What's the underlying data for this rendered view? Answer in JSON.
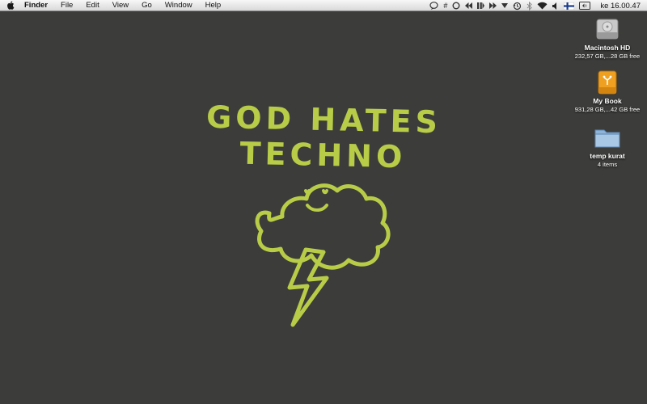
{
  "menubar": {
    "app_name": "Finder",
    "items": [
      "File",
      "Edit",
      "View",
      "Go",
      "Window",
      "Help"
    ],
    "status_icons": [
      "spotlight-bubble-icon",
      "hash-icon",
      "sync-circle-icon",
      "prev-track-icon",
      "play-pause-icon",
      "next-track-icon",
      "down-triangle-icon",
      "time-machine-icon",
      "bluetooth-icon",
      "wifi-icon",
      "volume-icon",
      "finnish-flag-icon",
      "display-icon"
    ],
    "clock": "ke 16.00.47"
  },
  "wallpaper": {
    "title": "GOD HATES TECHNO",
    "color": "#b8cc48"
  },
  "desktop_icons": [
    {
      "name": "Macintosh HD",
      "info": "232,57 GB,...28 GB free",
      "icon": "hard-drive-icon"
    },
    {
      "name": "My Book",
      "info": "931,28 GB,...42 GB free",
      "icon": "external-drive-icon"
    },
    {
      "name": "temp kurat",
      "info": "4 items",
      "icon": "folder-icon"
    }
  ]
}
